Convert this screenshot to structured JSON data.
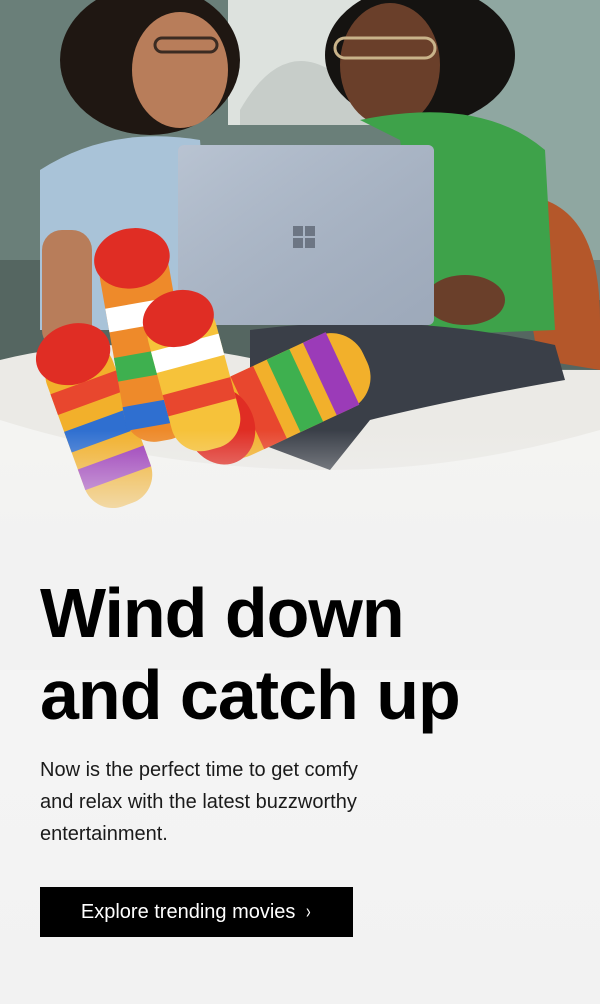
{
  "hero": {
    "headline": "Wind down and catch up",
    "body": "Now is the perfect time to get comfy and relax with the latest buzzworthy entertainment.",
    "cta_label": "Explore trending movies",
    "cta_icon": "chevron-right-icon",
    "cta_glyph": "›"
  },
  "image": {
    "subject": "two-people-on-bed-with-laptop",
    "brand_logo": "windows-logo-icon"
  },
  "colors": {
    "background": "#f2f2f2",
    "text": "#000000",
    "button_bg": "#000000",
    "button_text": "#ffffff"
  }
}
